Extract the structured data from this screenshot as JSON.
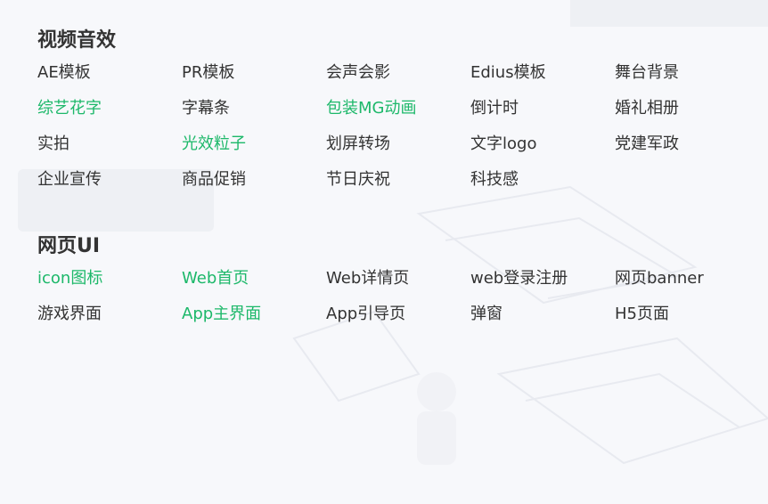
{
  "sections": [
    {
      "title": "视频音效",
      "items": [
        {
          "label": "AE模板",
          "highlight": false
        },
        {
          "label": "PR模板",
          "highlight": false
        },
        {
          "label": "会声会影",
          "highlight": false
        },
        {
          "label": "Edius模板",
          "highlight": false
        },
        {
          "label": "舞台背景",
          "highlight": false
        },
        {
          "label": "综艺花字",
          "highlight": true
        },
        {
          "label": "字幕条",
          "highlight": false
        },
        {
          "label": "包装MG动画",
          "highlight": true
        },
        {
          "label": "倒计时",
          "highlight": false
        },
        {
          "label": "婚礼相册",
          "highlight": false
        },
        {
          "label": "实拍",
          "highlight": false
        },
        {
          "label": "光效粒子",
          "highlight": true
        },
        {
          "label": "划屏转场",
          "highlight": false
        },
        {
          "label": "文字logo",
          "highlight": false
        },
        {
          "label": "党建军政",
          "highlight": false
        },
        {
          "label": "企业宣传",
          "highlight": false
        },
        {
          "label": "商品促销",
          "highlight": false
        },
        {
          "label": "节日庆祝",
          "highlight": false
        },
        {
          "label": "科技感",
          "highlight": false
        }
      ]
    },
    {
      "title": "网页UI",
      "items": [
        {
          "label": "icon图标",
          "highlight": true
        },
        {
          "label": "Web首页",
          "highlight": true
        },
        {
          "label": "Web详情页",
          "highlight": false
        },
        {
          "label": "web登录注册",
          "highlight": false
        },
        {
          "label": "网页banner",
          "highlight": false
        },
        {
          "label": "游戏界面",
          "highlight": false
        },
        {
          "label": "App主界面",
          "highlight": true
        },
        {
          "label": "App引导页",
          "highlight": false
        },
        {
          "label": "弹窗",
          "highlight": false
        },
        {
          "label": "H5页面",
          "highlight": false
        }
      ]
    }
  ],
  "colors": {
    "highlight": "#1db86a",
    "text": "#333333",
    "background": "#f7f8fb"
  }
}
